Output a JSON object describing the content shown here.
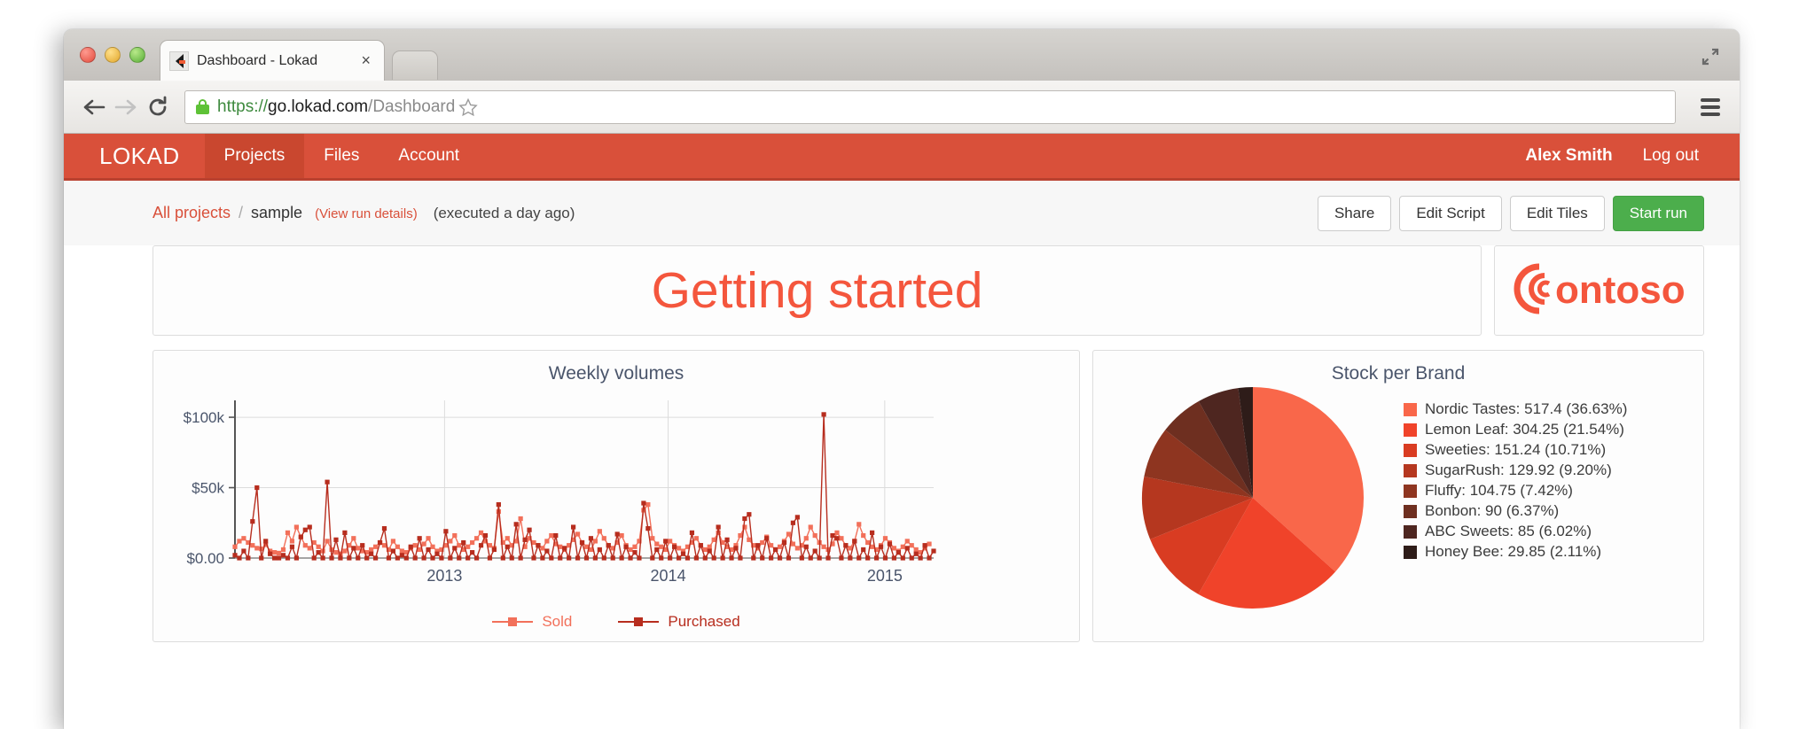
{
  "browser": {
    "tab_title": "Dashboard - Lokad",
    "tab_close_glyph": "×",
    "url_scheme": "https://",
    "url_host": "go.lokad.com",
    "url_path": "/Dashboard"
  },
  "appnav": {
    "brand": "LOKAD",
    "links": [
      {
        "label": "Projects",
        "active": true
      },
      {
        "label": "Files",
        "active": false
      },
      {
        "label": "Account",
        "active": false
      }
    ],
    "user_name": "Alex Smith",
    "logout": "Log out"
  },
  "breadcrumb": {
    "root": "All projects",
    "separator": "/",
    "project": "sample",
    "run_details": "(View run details)",
    "executed": "(executed a day ago)"
  },
  "actions": {
    "share": "Share",
    "edit_script": "Edit Script",
    "edit_tiles": "Edit Tiles",
    "start_run": "Start run",
    "primary_color": "#4cae4c"
  },
  "tiles": {
    "title_text": "Getting started",
    "title_color": "#f4563d",
    "logo_text": "ontoso",
    "logo_color": "#f4563d"
  },
  "chart_data": [
    {
      "type": "line",
      "title": "Weekly volumes",
      "xlabel": "",
      "ylabel": "",
      "xticks": [
        "2013",
        "2014",
        "2015"
      ],
      "yticks": [
        "$0.00",
        "$50k",
        "$100k"
      ],
      "ylim": [
        0,
        112000
      ],
      "grid": true,
      "legend_position": "bottom",
      "series": [
        {
          "name": "Sold",
          "color": "#f2705a",
          "values": [
            8000,
            12000,
            14000,
            11000,
            9000,
            7000,
            6500,
            9500,
            5000,
            4000,
            3500,
            6000,
            18000,
            12000,
            22000,
            15000,
            9000,
            7000,
            11000,
            8000,
            5000,
            12000,
            6000,
            4000,
            3000,
            5000,
            9000,
            14000,
            7000,
            5000,
            4000,
            6000,
            8000,
            11000,
            9000,
            6000,
            12000,
            8000,
            5000,
            4000,
            7000,
            9000,
            6000,
            10000,
            14000,
            8000,
            5000,
            6000,
            9000,
            12000,
            16000,
            9000,
            6000,
            8000,
            11000,
            14000,
            18000,
            12000,
            9000,
            7000,
            33000,
            11000,
            14000,
            9000,
            12000,
            28000,
            8000,
            14000,
            11000,
            9000,
            7000,
            12000,
            16000,
            10000,
            8000,
            6000,
            9000,
            13000,
            17000,
            11000,
            8000,
            6000,
            12000,
            19000,
            14000,
            9000,
            7000,
            11000,
            16000,
            9000,
            6000,
            8000,
            12000,
            34000,
            38000,
            14000,
            10000,
            8000,
            6000,
            12000,
            9000,
            7000,
            5000,
            8000,
            11000,
            14000,
            9000,
            6000,
            8000,
            13000,
            18000,
            11000,
            8000,
            6000,
            9000,
            16000,
            22000,
            13000,
            9000,
            7000,
            11000,
            15000,
            9000,
            6000,
            8000,
            12000,
            17000,
            10000,
            7000,
            9000,
            14000,
            22000,
            16000,
            11000,
            8000,
            6000,
            10000,
            18000,
            14000,
            9000,
            7000,
            12000,
            24000,
            16000,
            11000,
            8000,
            6000,
            9000,
            14000,
            11000,
            7000,
            5000,
            8000,
            12000,
            9000,
            6000,
            4000,
            7000,
            10000
          ]
        },
        {
          "name": "Purchased",
          "color": "#b72d1e",
          "values": [
            2000,
            0,
            5000,
            0,
            26000,
            50000,
            0,
            12000,
            3000,
            0,
            0,
            2000,
            0,
            8000,
            0,
            15000,
            20000,
            22000,
            0,
            4000,
            0,
            54000,
            0,
            13000,
            0,
            18000,
            0,
            7000,
            0,
            9000,
            0,
            3000,
            0,
            11000,
            21000,
            0,
            5000,
            0,
            2000,
            0,
            8000,
            0,
            14000,
            0,
            6000,
            0,
            3000,
            0,
            19000,
            0,
            7000,
            0,
            11000,
            0,
            4000,
            0,
            9000,
            16000,
            0,
            6000,
            38000,
            0,
            8000,
            0,
            24000,
            0,
            13000,
            20000,
            0,
            9000,
            0,
            5000,
            0,
            16000,
            0,
            7000,
            0,
            22000,
            0,
            11000,
            0,
            14000,
            0,
            6000,
            0,
            9000,
            0,
            17000,
            0,
            8000,
            0,
            4000,
            0,
            39000,
            21000,
            0,
            6000,
            0,
            12000,
            0,
            8000,
            0,
            3000,
            0,
            18000,
            0,
            9000,
            0,
            5000,
            0,
            22000,
            0,
            13000,
            0,
            7000,
            0,
            28000,
            31000,
            0,
            9000,
            0,
            14000,
            0,
            6000,
            0,
            11000,
            0,
            25000,
            29000,
            0,
            8000,
            0,
            5000,
            0,
            102000,
            0,
            16000,
            14000,
            0,
            9000,
            0,
            12000,
            0,
            6000,
            0,
            18000,
            0,
            8000,
            0,
            10000,
            0,
            4000,
            0,
            7000,
            0,
            3000,
            0,
            9000,
            0,
            5000
          ]
        }
      ]
    },
    {
      "type": "pie",
      "title": "Stock per Brand",
      "legend_position": "right",
      "labels": [
        "Nordic Tastes",
        "Lemon Leaf",
        "Sweeties",
        "SugarRush",
        "Fluffy",
        "Bonbon",
        "ABC Sweets",
        "Honey Bee"
      ],
      "values": [
        517.4,
        304.25,
        151.24,
        129.92,
        104.75,
        90,
        85,
        29.85
      ],
      "percents": [
        "36.63%",
        "21.54%",
        "10.71%",
        "9.20%",
        "7.42%",
        "6.37%",
        "6.02%",
        "2.11%"
      ],
      "colors": [
        "#f9674a",
        "#f0432a",
        "#d93c22",
        "#b5371f",
        "#8e3520",
        "#6e2f20",
        "#4e2620",
        "#2e1c19"
      ],
      "legend_entries": [
        "Nordic Tastes: 517.4 (36.63%)",
        "Lemon Leaf: 304.25 (21.54%)",
        "Sweeties: 151.24 (10.71%)",
        "SugarRush: 129.92 (9.20%)",
        "Fluffy: 104.75 (7.42%)",
        "Bonbon: 90 (6.37%)",
        "ABC Sweets: 85 (6.02%)",
        "Honey Bee: 29.85 (2.11%)"
      ]
    }
  ]
}
